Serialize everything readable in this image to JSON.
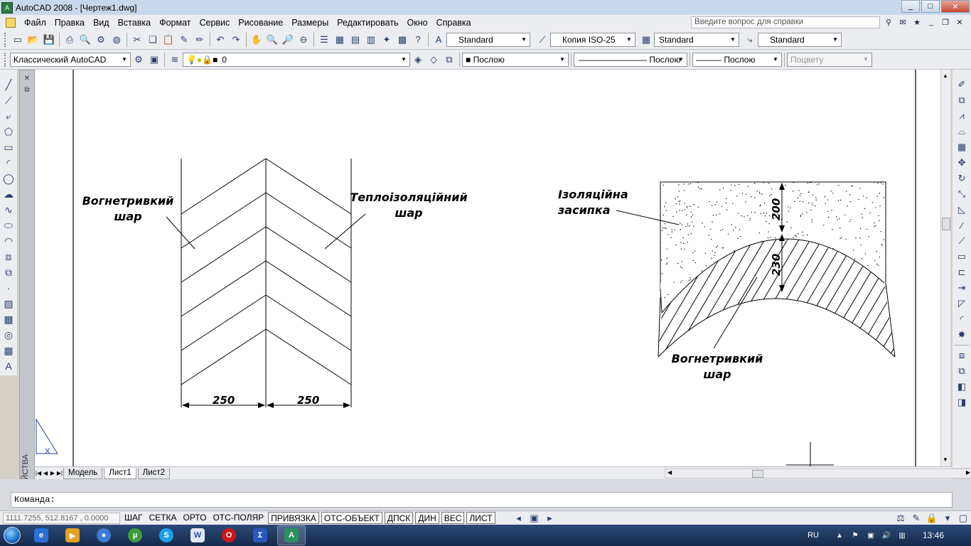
{
  "window": {
    "title": "AutoCAD 2008 - [Чертеж1.dwg]",
    "controls": [
      "_",
      "□",
      "✕"
    ]
  },
  "menu": {
    "items": [
      "Файл",
      "Правка",
      "Вид",
      "Вставка",
      "Формат",
      "Сервис",
      "Рисование",
      "Размеры",
      "Редактировать",
      "Окно",
      "Справка"
    ],
    "help_placeholder": "Введите вопрос для справки"
  },
  "toolbar1": {
    "text_style": "Standard",
    "dim_style": "Копия ISO-25",
    "table_style": "Standard",
    "multileader_style": "Standard"
  },
  "toolbar2": {
    "workspace": "Классический AutoCAD",
    "layer": "0",
    "color": "Послою",
    "linetype": "Послою",
    "lineweight": "Послою",
    "plot_style": "Поцвету"
  },
  "drawing": {
    "left_labels": {
      "refractory": [
        "Вогнетривкий",
        "шар"
      ],
      "insulation": [
        "Теплоізоляційний",
        "шар"
      ]
    },
    "left_dims": [
      "250",
      "250"
    ],
    "right_labels": {
      "backfill": [
        "Ізоляційна",
        "засипка"
      ],
      "refractory": [
        "Вогнетривкий",
        "шар"
      ]
    },
    "right_dims": [
      "200",
      "230"
    ]
  },
  "props_strip": {
    "label": "СВОЙСТВА"
  },
  "tabs": [
    "Модель",
    "Лист1",
    "Лист2"
  ],
  "command": {
    "prompt": "Команда:"
  },
  "status": {
    "coords": "1111.7255, 512.8167 , 0.0000",
    "buttons": [
      "ШАГ",
      "СЕТКА",
      "ОРТО",
      "ОТС-ПОЛЯР",
      "ПРИВЯЗКА",
      "ОТС-ОБЪЕКТ",
      "ДПСК",
      "ДИН",
      "ВЕС",
      "ЛИСТ"
    ],
    "on_buttons": [
      "ПРИВЯЗКА",
      "ОТС-ОБЪЕКТ",
      "ДПСК",
      "ДИН",
      "ВЕС",
      "ЛИСТ"
    ]
  },
  "taskbar": {
    "lang": "RU",
    "clock": "13:46"
  },
  "colors": {
    "titlebar": "#c8d8ec",
    "toolbar": "#ecedf0",
    "taskbar": "#16294a",
    "canvas": "#ffffff"
  }
}
